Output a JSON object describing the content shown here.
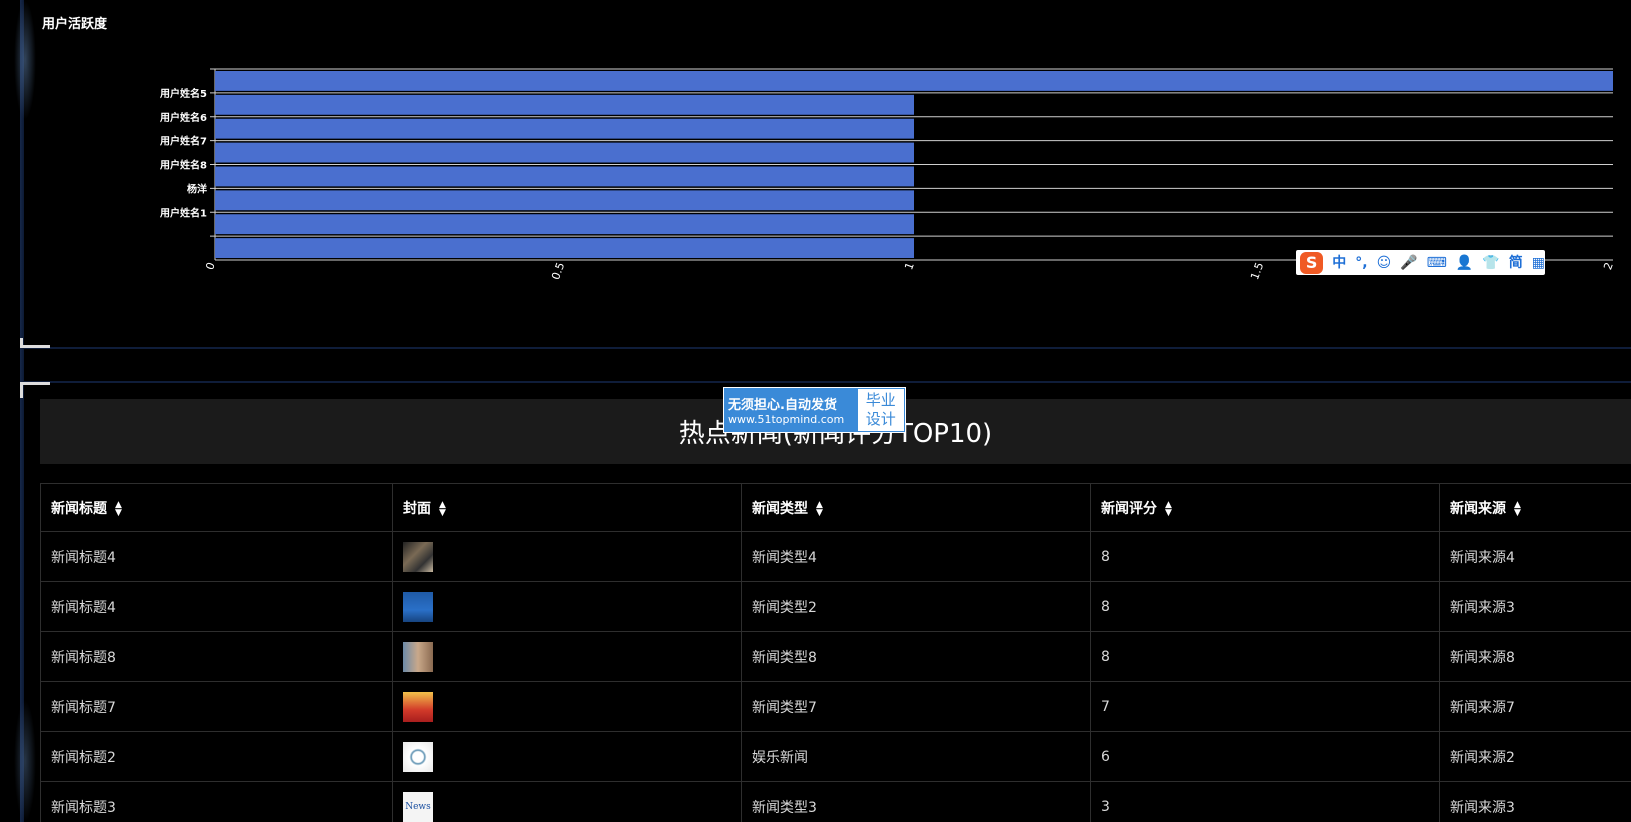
{
  "activity_panel": {
    "title": "用户活跃度"
  },
  "chart_data": {
    "type": "bar",
    "orientation": "horizontal",
    "title": "用户活跃度",
    "categories": [
      "",
      "用户姓名1",
      "杨洋",
      "用户姓名8",
      "用户姓名7",
      "用户姓名6",
      "用户姓名5",
      ""
    ],
    "values": [
      1,
      1,
      1,
      1,
      1,
      1,
      1,
      2
    ],
    "xlim": [
      0,
      2
    ],
    "x_ticks": [
      "0",
      "0.5",
      "1",
      "1.5",
      "2"
    ],
    "bar_color": "#4a6fcf",
    "grid": true
  },
  "ime_toolbar": {
    "logo": "S",
    "items": [
      "中",
      "°,",
      "☺",
      "🎤",
      "⌨",
      "👤",
      "👕",
      "简",
      "▦"
    ]
  },
  "watermark": {
    "line1": "无须担心.自动发货",
    "line2": "www.51topmind.com",
    "badge_line1": "毕业",
    "badge_line2": "设计"
  },
  "news_panel": {
    "title": "热点新闻(新闻评分TOP10)",
    "columns": [
      "新闻标题",
      "封面",
      "新闻类型",
      "新闻评分",
      "新闻来源"
    ],
    "rows": [
      {
        "title": "新闻标题4",
        "type": "新闻类型4",
        "score": "8",
        "source": "新闻来源4"
      },
      {
        "title": "新闻标题4",
        "type": "新闻类型2",
        "score": "8",
        "source": "新闻来源3"
      },
      {
        "title": "新闻标题8",
        "type": "新闻类型8",
        "score": "8",
        "source": "新闻来源8"
      },
      {
        "title": "新闻标题7",
        "type": "新闻类型7",
        "score": "7",
        "source": "新闻来源7"
      },
      {
        "title": "新闻标题2",
        "type": "娱乐新闻",
        "score": "6",
        "source": "新闻来源2"
      },
      {
        "title": "新闻标题3",
        "type": "新闻类型3",
        "score": "3",
        "source": "新闻来源3"
      }
    ],
    "thumb_text_last": "News"
  },
  "colors": {
    "background": "#000000",
    "bar": "#4a6fcf",
    "header_bg": "#1b1b1b",
    "frame": "#16284a"
  }
}
